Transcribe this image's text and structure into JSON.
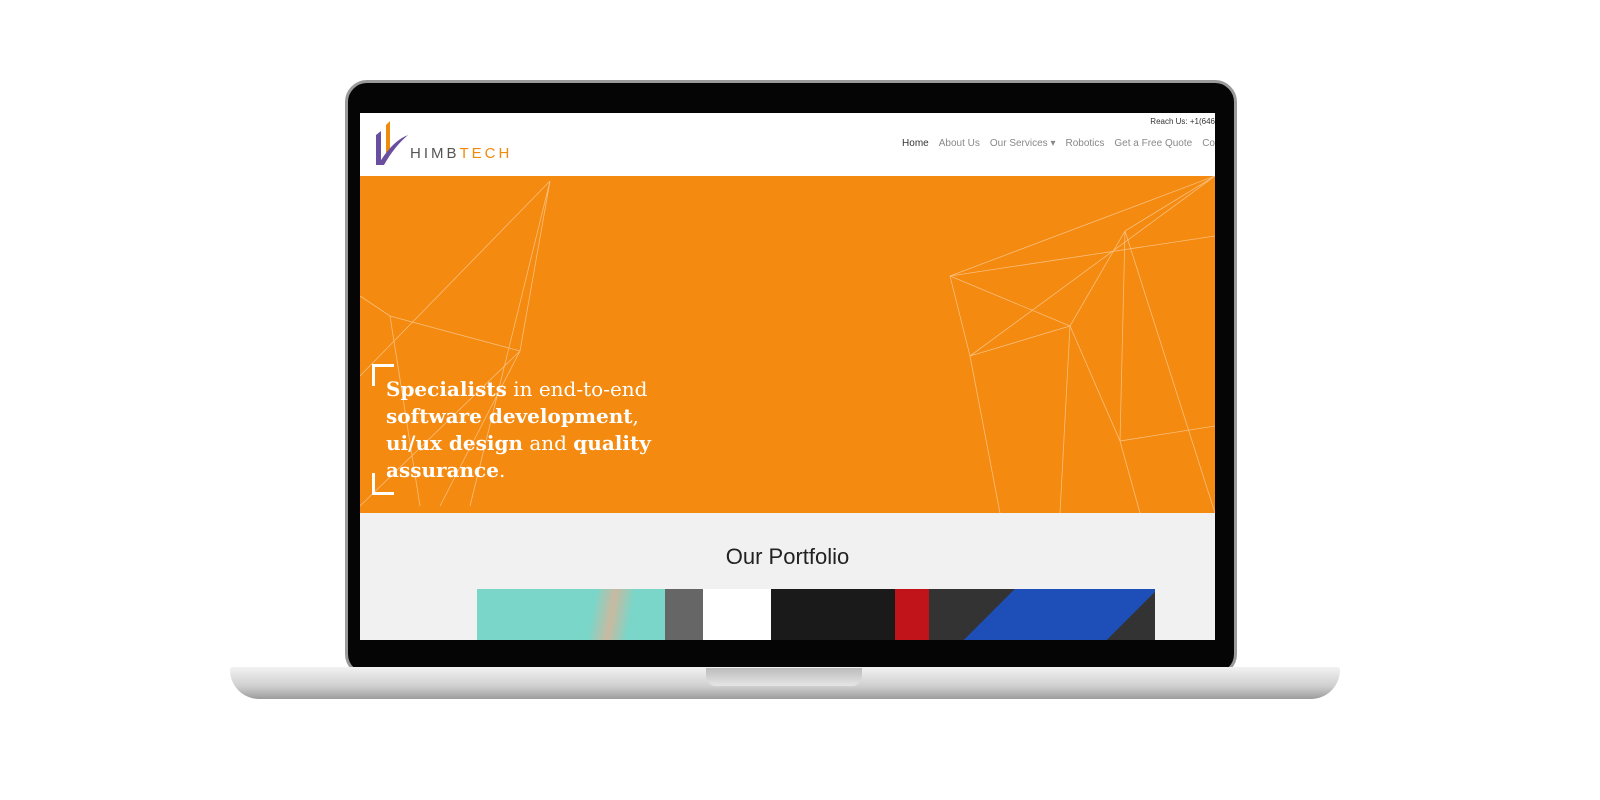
{
  "header": {
    "logo_text_1": "HIMB",
    "logo_text_2": "TECH",
    "reach": "Reach Us: +1(646",
    "nav": [
      {
        "label": "Home"
      },
      {
        "label": "About Us"
      },
      {
        "label": "Our Services ▾"
      },
      {
        "label": "Robotics"
      },
      {
        "label": "Get a Free Quote"
      },
      {
        "label": "Co"
      }
    ]
  },
  "hero": {
    "w1": "Specialists",
    "w2": " in end-to-end",
    "w3": "software development",
    "w4": ",",
    "w5": "ui/ux design",
    "w6": " and ",
    "w7": "quality",
    "w8": "assurance",
    "w9": "."
  },
  "portfolio": {
    "title": "Our Portfolio"
  }
}
